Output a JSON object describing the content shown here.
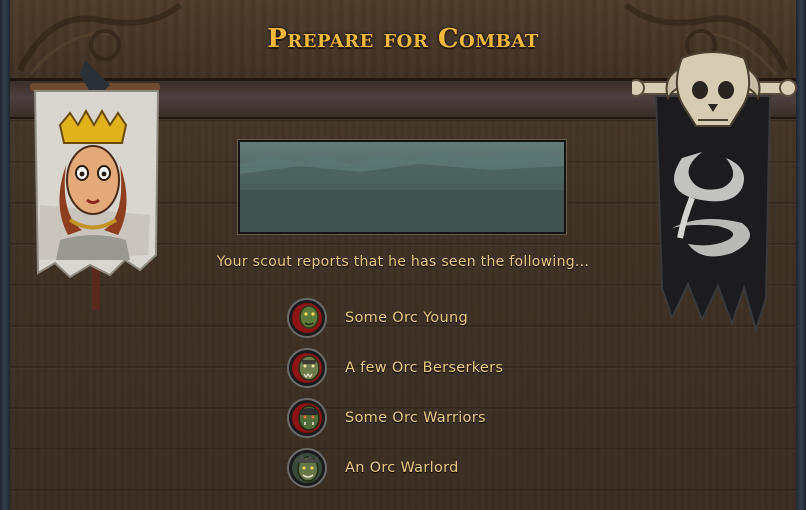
{
  "title": "Prepare for Combat",
  "scout_message": "Your scout reports that he has seen the following...",
  "enemies": [
    {
      "label": "Some Orc Young",
      "icon": "orc-young-portrait-icon"
    },
    {
      "label": "A few Orc Berserkers",
      "icon": "orc-berserker-portrait-icon"
    },
    {
      "label": "Some Orc Warriors",
      "icon": "orc-warrior-portrait-icon"
    },
    {
      "label": "An Orc Warlord",
      "icon": "orc-warlord-portrait-icon"
    }
  ],
  "colors": {
    "title_gold": "#f1b83a",
    "text_gold": "#e9c982",
    "wood_dark": "#3a2d21",
    "banner_cloth_left": "#d9d6cf",
    "banner_cloth_right": "#1c1c1e"
  },
  "banners": {
    "left": "noble-house-banner-icon",
    "right": "orc-skull-banner-icon"
  }
}
